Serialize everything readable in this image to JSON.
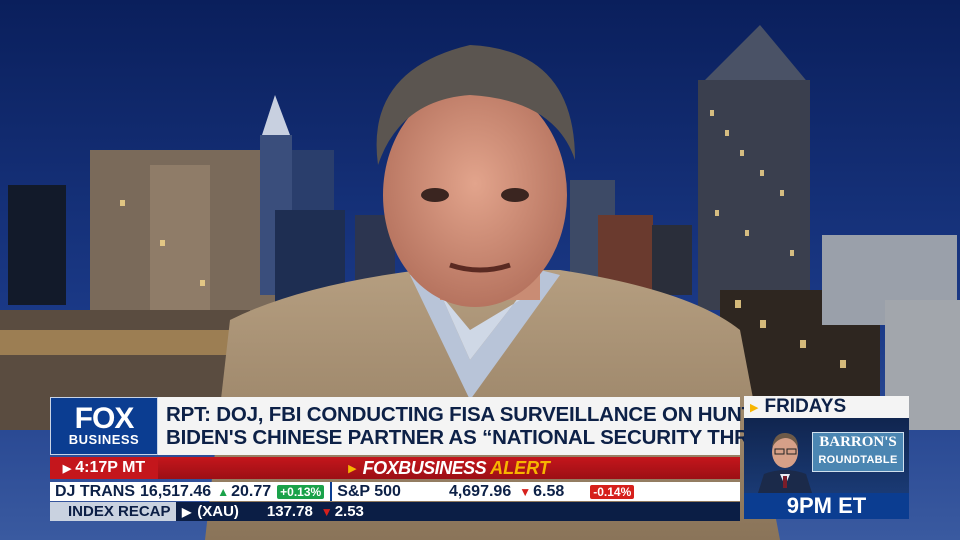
{
  "logo": {
    "top": "FOX",
    "bottom": "BUSINESS"
  },
  "headline": {
    "line1": "RPT: DOJ, FBI CONDUCTING FISA SURVEILLANCE ON HUNTER",
    "line2": "BIDEN'S CHINESE PARTNER AS “NATIONAL SECURITY THREAT”"
  },
  "time": "4:17P MT",
  "alert": {
    "brand": "FOXBUSINESS",
    "word": "ALERT"
  },
  "ticker": {
    "items": [
      {
        "name": "DJ TRANS",
        "value": "16,517.46",
        "dir": "up",
        "change": "20.77",
        "pct": "+0.13%"
      },
      {
        "name": "S&P 500",
        "value": "4,697.96",
        "dir": "down",
        "change": "6.58",
        "pct": "-0.14%"
      }
    ]
  },
  "recap": {
    "label": "INDEX RECAP",
    "symbol": "(XAU)",
    "value": "137.78",
    "change": "2.53"
  },
  "promo": {
    "day": "FRIDAYS",
    "brand": "BARRON'S",
    "show": "ROUNDTABLE",
    "time": "9PM ET"
  },
  "colors": {
    "fox_blue": "#0b3d91",
    "alert_red": "#c4161c",
    "alert_gold": "#f7b500",
    "up_green": "#1aa24a",
    "down_red": "#d6201c"
  }
}
